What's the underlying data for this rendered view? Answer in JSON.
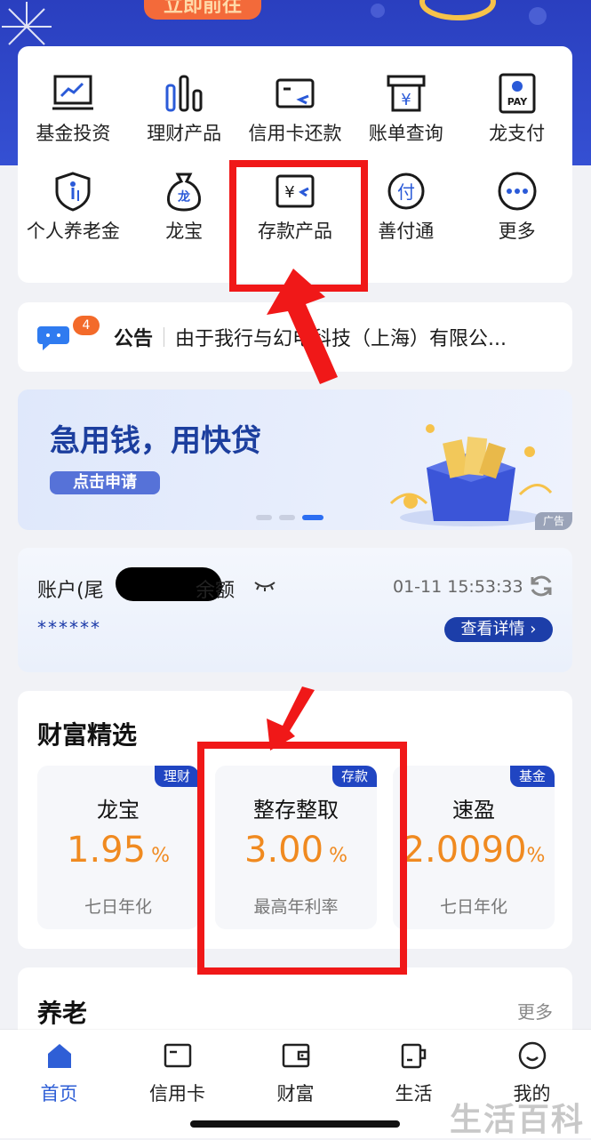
{
  "banner": {
    "cta_label": "立即前往"
  },
  "menu": {
    "row1": [
      {
        "label": "基金投资",
        "icon": "fund-chart-icon"
      },
      {
        "label": "理财产品",
        "icon": "bar-chart-icon"
      },
      {
        "label": "信用卡还款",
        "icon": "card-repay-icon"
      },
      {
        "label": "账单查询",
        "icon": "bill-icon"
      },
      {
        "label": "龙支付",
        "icon": "pay-icon"
      }
    ],
    "row2": [
      {
        "label": "个人养老金",
        "icon": "pension-shield-icon"
      },
      {
        "label": "龙宝",
        "icon": "money-bag-icon"
      },
      {
        "label": "存款产品",
        "icon": "deposit-icon"
      },
      {
        "label": "善付通",
        "icon": "pay-circle-icon"
      },
      {
        "label": "更多",
        "icon": "more-icon"
      }
    ],
    "pay_icon_text": "PAY",
    "bag_icon_text": "龙",
    "fu_icon_text": "付"
  },
  "notice": {
    "badge": "4",
    "title": "公告",
    "text": "由于我行与幻电科技（上海）有限公..."
  },
  "promo": {
    "title": "急用钱，用快贷",
    "button": "点击申请",
    "ad_tag": "广告",
    "active_dot": 2
  },
  "account": {
    "label": "账户(尾",
    "balance_label": "余额",
    "time": "01-11 15:53:33",
    "masked_balance": "******",
    "detail_button": "查看详情"
  },
  "wealth": {
    "title": "财富精选",
    "products": [
      {
        "tag": "理财",
        "name": "龙宝",
        "rate": "1.95",
        "unit": "%",
        "sub": "七日年化"
      },
      {
        "tag": "存款",
        "name": "整存整取",
        "rate": "3.00",
        "unit": "%",
        "sub": "最高年利率"
      },
      {
        "tag": "基金",
        "name": "速盈",
        "rate": "2.0090",
        "unit": "%",
        "sub": "七日年化"
      }
    ]
  },
  "retire": {
    "title": "养老",
    "more": "更多"
  },
  "tabbar": [
    {
      "label": "首页",
      "icon": "home-icon",
      "active": true
    },
    {
      "label": "信用卡",
      "icon": "credit-card-icon",
      "active": false
    },
    {
      "label": "财富",
      "icon": "wallet-icon",
      "active": false
    },
    {
      "label": "生活",
      "icon": "cup-icon",
      "active": false
    },
    {
      "label": "我的",
      "icon": "smile-icon",
      "active": false
    }
  ],
  "watermark": "生活百科",
  "colors": {
    "brand_blue": "#2045c2",
    "rate_orange": "#f08a20",
    "highlight_red": "#f01818",
    "tab_active": "#2f5fd6"
  }
}
